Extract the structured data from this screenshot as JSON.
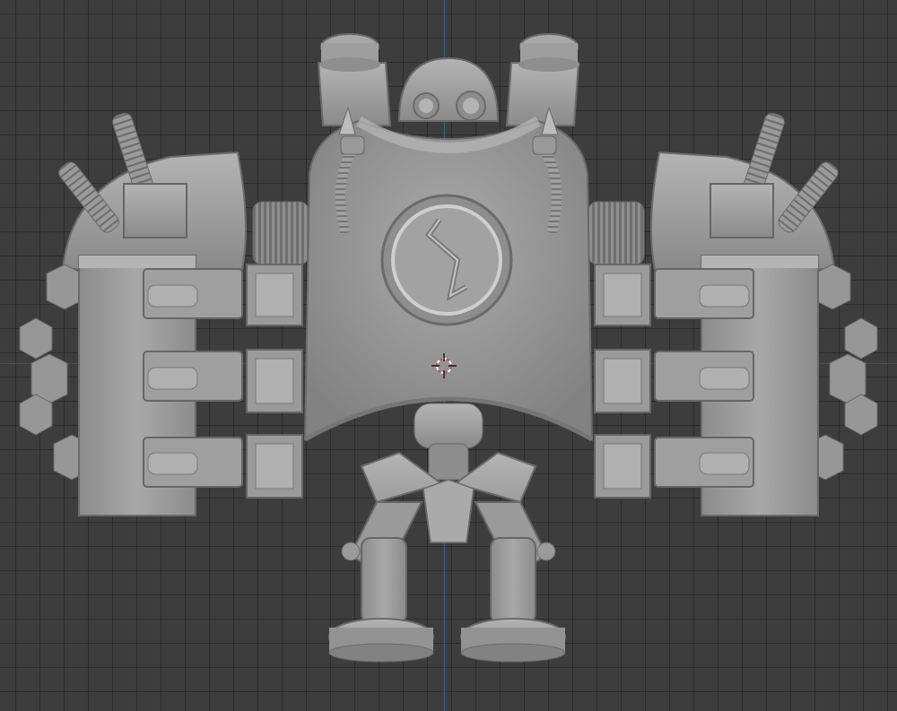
{
  "viewport": {
    "background_color": "#3d3d3d",
    "grid_color": "#333333",
    "axis_x_color": "#7a3a3f",
    "axis_y_color": "#3e5f8f"
  },
  "model": {
    "material_color": "#9c9c9c",
    "shadow_color": "#6e6e6e",
    "highlight_color": "#c2c2c2"
  },
  "cursor": {
    "icon": "3d-cursor-icon",
    "ring_color_a": "#d24b4b",
    "ring_color_b": "#ffffff"
  }
}
